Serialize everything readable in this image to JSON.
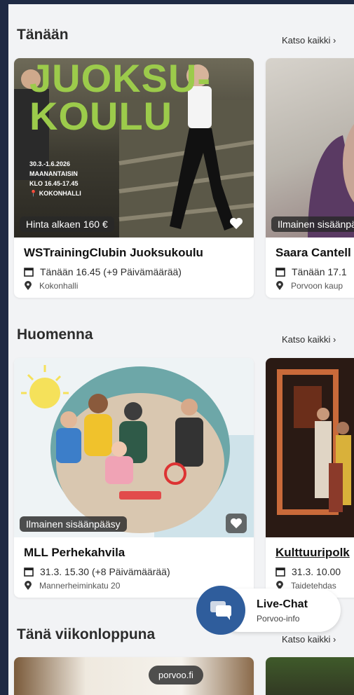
{
  "sections": {
    "today": {
      "title": "Tänään",
      "see_all": "Katso kaikki"
    },
    "tomorrow": {
      "title": "Huomenna",
      "see_all": "Katso kaikki"
    },
    "weekend": {
      "title": "Tänä viikonloppuna",
      "see_all": "Katso kaikki"
    }
  },
  "today_cards": [
    {
      "poster": {
        "line1": "JUOKSU-",
        "line2": "KOULU",
        "dates": "30.3.-1.6.2026",
        "days": "MAANANTAISIN",
        "time": "KLO 16.45-17.45",
        "place": "KOKONHALLI"
      },
      "price": "Hinta alkaen 160 €",
      "title": "WSTrainingClubin Juoksukoulu",
      "date": "Tänään 16.45 (+9 Päivämäärää)",
      "location": "Kokonhalli"
    },
    {
      "price": "Ilmainen sisäänpääsy",
      "title": "Saara Cantell",
      "date": "Tänään 17.1",
      "location": "Porvoon kaup"
    }
  ],
  "tomorrow_cards": [
    {
      "price": "Ilmainen sisäänpääsy",
      "title": "MLL Perhekahvila",
      "date": "31.3. 15.30 (+8 Päivämäärää)",
      "location": "Mannerheiminkatu 20"
    },
    {
      "title": "Kulttuuripolk",
      "date": "31.3. 10.00",
      "location": "Taidetehdas"
    }
  ],
  "chat": {
    "title": "Live-Chat",
    "subtitle": "Porvoo-info"
  },
  "footer_badge": "porvoo.fi",
  "colors": {
    "accent": "#2f5d9c",
    "poster_green": "#9ccb4b",
    "background": "#f2f3f5"
  }
}
